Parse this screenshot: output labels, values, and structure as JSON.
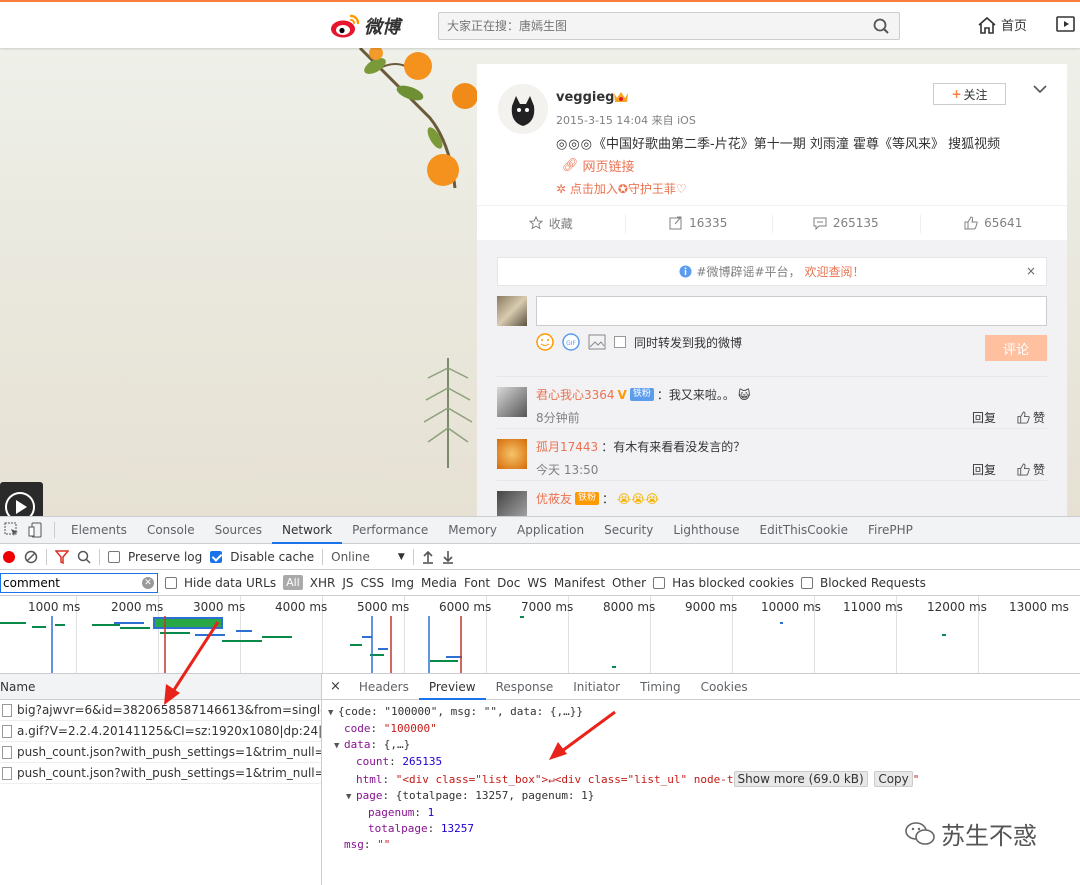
{
  "weibo": {
    "logo_text": "微博",
    "search_placeholder": "大家正在搜：唐嫣生图",
    "nav_home": "首页"
  },
  "post": {
    "username": "veggieg",
    "time": "2015-3-15 14:04 来自 iOS",
    "text": "《中国好歌曲第二季-片花》第十一期 刘雨潼 霍尊《等风来》 搜狐视频",
    "link_text": "网页链接",
    "join_text": "点击加入✪守护王菲♡",
    "follow_label": "关注",
    "actions": {
      "favorite": "收藏",
      "repost": "16335",
      "comment": "265135",
      "like": "65641"
    }
  },
  "comments_panel": {
    "notice_text": "#微博辟谣#平台，",
    "notice_link": "欢迎查阅！",
    "notice_close": "×",
    "forward_label": "同时转发到我的微博",
    "submit_label": "评论",
    "reply_label": "回复",
    "like_label": "赞",
    "items": [
      {
        "name": "君心我心3364",
        "badge": "铁粉",
        "text": "：我又来啦。。",
        "time": "8分钟前"
      },
      {
        "name": "孤月17443",
        "badge": "",
        "text": "：有木有来看看没发言的？",
        "time": "今天 13:50"
      },
      {
        "name": "优莜友",
        "badge": "铁粉",
        "text": "：",
        "time": ""
      }
    ]
  },
  "devtools": {
    "tabs": [
      "Elements",
      "Console",
      "Sources",
      "Network",
      "Performance",
      "Memory",
      "Application",
      "Security",
      "Lighthouse",
      "EditThisCookie",
      "FirePHP"
    ],
    "active_tab": "Network",
    "toolbar": {
      "preserve_log": "Preserve log",
      "disable_cache": "Disable cache",
      "throttle": "Online"
    },
    "filter": {
      "value": "comment",
      "hide_data_urls": "Hide data URLs",
      "all": "All",
      "types": [
        "XHR",
        "JS",
        "CSS",
        "Img",
        "Media",
        "Font",
        "Doc",
        "WS",
        "Manifest",
        "Other"
      ],
      "blocked_cookies": "Has blocked cookies",
      "blocked_requests": "Blocked Requests"
    },
    "timeline_ticks": [
      "1000 ms",
      "2000 ms",
      "3000 ms",
      "4000 ms",
      "5000 ms",
      "6000 ms",
      "7000 ms",
      "8000 ms",
      "9000 ms",
      "10000 ms",
      "11000 ms",
      "12000 ms",
      "13000 ms"
    ],
    "list_header": "Name",
    "requests": [
      "big?ajwvr=6&id=3820658587146613&from=singleWei...",
      "a.gif?V=2.2.4.20141125&CI=sz:1920x1080|dp:24|ac:Mo...",
      "push_count.json?with_push_settings=1&trim_null=1&w...",
      "push_count.json?with_push_settings=1&trim_null=1&w..."
    ],
    "detail_tabs": [
      "Headers",
      "Preview",
      "Response",
      "Initiator",
      "Timing",
      "Cookies"
    ],
    "active_detail_tab": "Preview",
    "preview": {
      "summary": "{code: \"100000\", msg: \"\", data: {,…}}",
      "code_key": "code",
      "code_val": "\"100000\"",
      "data_key": "data",
      "data_summary": "{,…}",
      "count_key": "count",
      "count_val": "265135",
      "html_key": "html",
      "html_val": "\"<div class=\"list_box\">↵<div class=\"list_ul\" node-t",
      "show_more": "Show more (69.0 kB)",
      "copy": "Copy",
      "html_tail": "\"",
      "page_key": "page",
      "page_summary": "{totalpage: 13257, pagenum: 1}",
      "pagenum_key": "pagenum",
      "pagenum_val": "1",
      "totalpage_key": "totalpage",
      "totalpage_val": "13257",
      "msg_key": "msg",
      "msg_val": "\"\""
    }
  },
  "watermark": "苏生不惑"
}
